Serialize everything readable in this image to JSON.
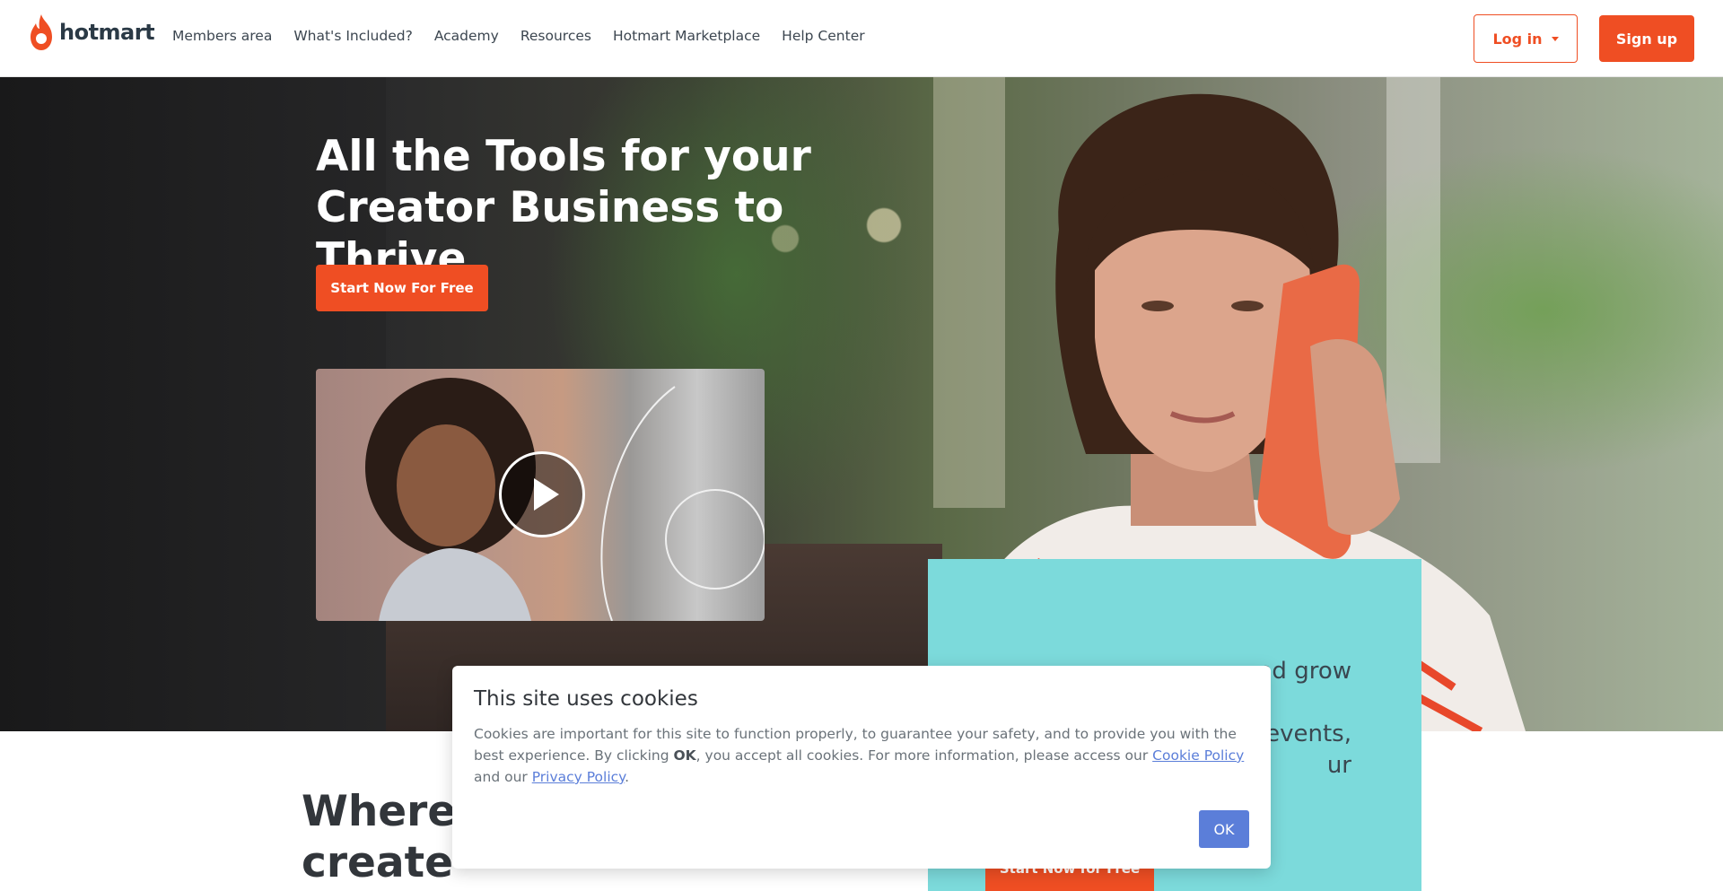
{
  "brand": {
    "name": "hotmart",
    "accent": "#ef4e23",
    "teal": "#7cdadb"
  },
  "nav": {
    "items": [
      "Members area",
      "What's Included?",
      "Academy",
      "Resources",
      "Hotmart Marketplace",
      "Help Center"
    ]
  },
  "header": {
    "login_label": "Log in",
    "signup_label": "Sign up"
  },
  "hero": {
    "title": "All the Tools for your Creator Business to Thrive",
    "cta": "Start Now For Free"
  },
  "teal_card": {
    "line1": "nd grow",
    "line2": "events,",
    "line3": "ur",
    "cta": "Start Now for Free"
  },
  "section": {
    "title_line1": "Where c",
    "title_line2": "create"
  },
  "cookie": {
    "title": "This site uses cookies",
    "text_before": "Cookies are important for this site to function properly, to guarantee your safety, and to provide you with the best experience. By clicking ",
    "text_bold": "OK",
    "text_middle": ", you accept all cookies. For more information, please access our ",
    "cookie_policy_link": "Cookie Policy",
    "text_and": " and our ",
    "privacy_policy_link": "Privacy Policy",
    "text_end": ".",
    "ok_label": "OK"
  }
}
